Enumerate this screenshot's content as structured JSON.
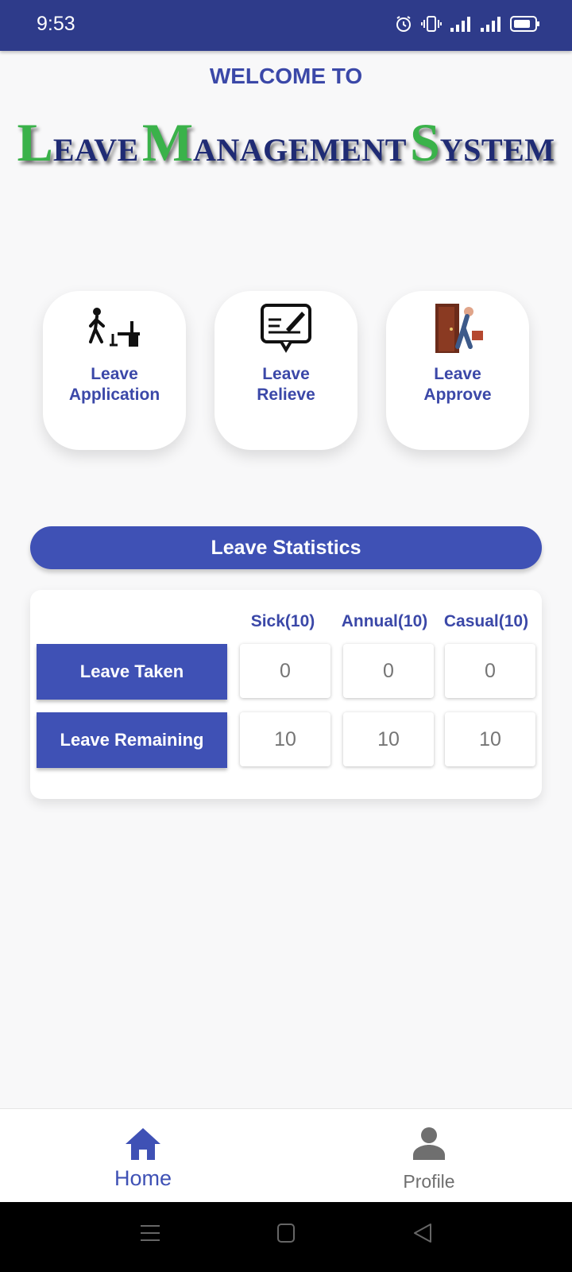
{
  "status_bar": {
    "time": "9:53"
  },
  "header": {
    "welcome": "WELCOME TO",
    "logo": {
      "w1_initial": "L",
      "w1_rest": "EAVE",
      "w2_initial": "M",
      "w2_rest": "ANAGEMENT",
      "w3_initial": "S",
      "w3_rest": "YSTEM"
    }
  },
  "cards": [
    {
      "line1": "Leave",
      "line2": "Application",
      "icon": "person-walking-to-desk-icon"
    },
    {
      "line1": "Leave",
      "line2": "Relieve",
      "icon": "signed-document-icon"
    },
    {
      "line1": "Leave",
      "line2": "Approve",
      "icon": "person-leaving-door-icon"
    }
  ],
  "statistics": {
    "title": "Leave Statistics",
    "columns": [
      "Sick(10)",
      "Annual(10)",
      "Casual(10)"
    ],
    "rows": [
      {
        "label": "Leave Taken",
        "values": [
          "0",
          "0",
          "0"
        ]
      },
      {
        "label": "Leave Remaining",
        "values": [
          "10",
          "10",
          "10"
        ]
      }
    ]
  },
  "bottom_nav": {
    "items": [
      {
        "label": "Home",
        "icon": "home-icon",
        "active": true
      },
      {
        "label": "Profile",
        "icon": "person-icon",
        "active": false
      }
    ]
  },
  "colors": {
    "primary": "#3f51b5",
    "status_bar": "#2e3b8a",
    "logo_green": "#3ab24a",
    "logo_navy": "#1f2b74",
    "inactive": "#6f6f6f"
  }
}
